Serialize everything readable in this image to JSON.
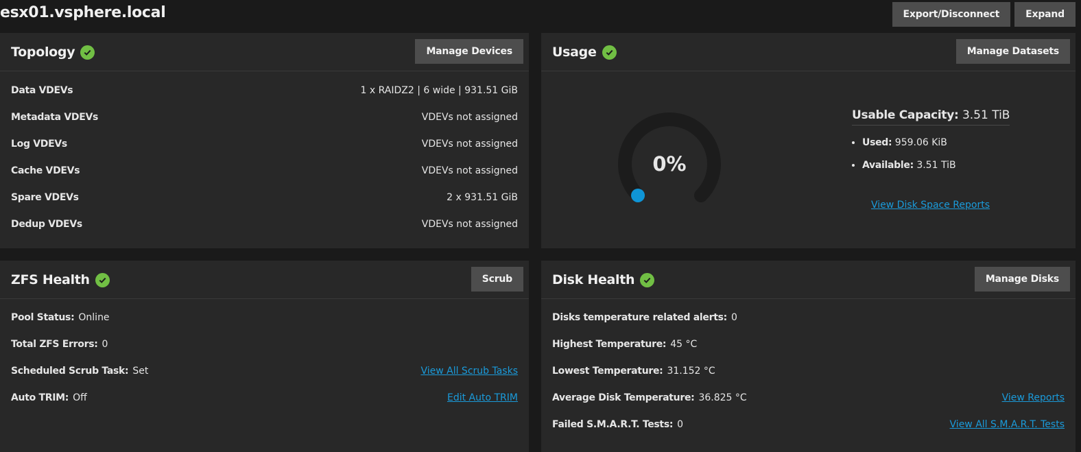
{
  "pool": {
    "name": "esx01.vsphere.local",
    "export_label": "Export/Disconnect",
    "expand_label": "Expand"
  },
  "topology": {
    "title": "Topology",
    "button": "Manage Devices",
    "rows": [
      {
        "label": "Data VDEVs",
        "value": "1 x RAIDZ2 | 6 wide | 931.51 GiB"
      },
      {
        "label": "Metadata VDEVs",
        "value": "VDEVs not assigned"
      },
      {
        "label": "Log VDEVs",
        "value": "VDEVs not assigned"
      },
      {
        "label": "Cache VDEVs",
        "value": "VDEVs not assigned"
      },
      {
        "label": "Spare VDEVs",
        "value": "2 x 931.51 GiB"
      },
      {
        "label": "Dedup VDEVs",
        "value": "VDEVs not assigned"
      }
    ]
  },
  "usage": {
    "title": "Usage",
    "button": "Manage Datasets",
    "percent_label": "0%",
    "percent_value": 0,
    "capacity_label": "Usable Capacity:",
    "capacity_value": "3.51 TiB",
    "used_label": "Used:",
    "used_value": "959.06 KiB",
    "available_label": "Available:",
    "available_value": "3.51 TiB",
    "report_link": "View Disk Space Reports"
  },
  "zfs_health": {
    "title": "ZFS Health",
    "button": "Scrub",
    "rows": [
      {
        "label": "Pool Status:",
        "value": "Online",
        "link": ""
      },
      {
        "label": "Total ZFS Errors:",
        "value": "0",
        "link": ""
      },
      {
        "label": "Scheduled Scrub Task:",
        "value": "Set",
        "link": "View All Scrub Tasks"
      },
      {
        "label": "Auto TRIM:",
        "value": "Off",
        "link": "Edit Auto TRIM"
      }
    ]
  },
  "disk_health": {
    "title": "Disk Health",
    "button": "Manage Disks",
    "rows": [
      {
        "label": "Disks temperature related alerts:",
        "value": "0",
        "link": ""
      },
      {
        "label": "Highest Temperature:",
        "value": "45 °C",
        "link": ""
      },
      {
        "label": "Lowest Temperature:",
        "value": "31.152 °C",
        "link": ""
      },
      {
        "label": "Average Disk Temperature:",
        "value": "36.825 °C",
        "link": "View Reports"
      },
      {
        "label": "Failed S.M.A.R.T. Tests:",
        "value": "0",
        "link": "View All S.M.A.R.T. Tests"
      }
    ]
  },
  "colors": {
    "accent": "#1a9bdb",
    "healthy": "#71bf44",
    "card": "#282828",
    "background": "#1a1a1a"
  }
}
